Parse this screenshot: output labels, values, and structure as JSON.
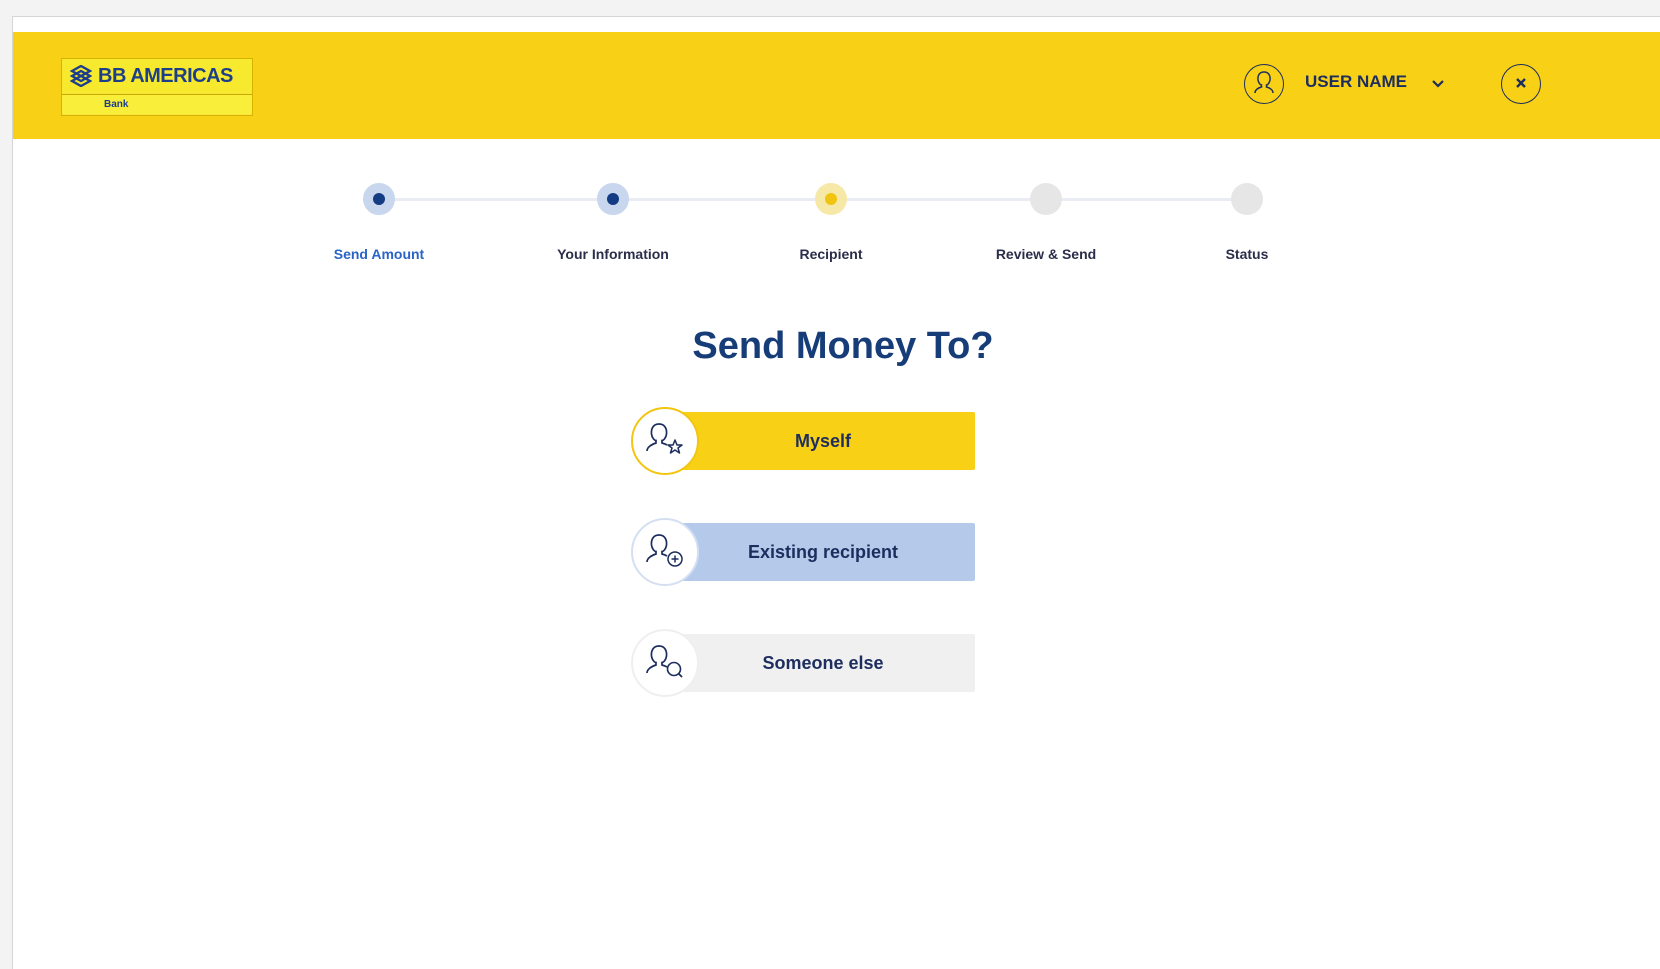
{
  "header": {
    "logo_text": "BB AMERICAS",
    "logo_subtext": "Bank",
    "user_name": "USER NAME"
  },
  "steps": [
    {
      "label": "Send Amount",
      "state": "done"
    },
    {
      "label": "Your Information",
      "state": "done"
    },
    {
      "label": "Recipient",
      "state": "current"
    },
    {
      "label": "Review & Send",
      "state": "todo"
    },
    {
      "label": "Status",
      "state": "todo"
    }
  ],
  "main": {
    "title": "Send Money To?",
    "options": [
      {
        "label": "Myself",
        "icon": "user-star-icon"
      },
      {
        "label": "Existing recipient",
        "icon": "user-add-icon"
      },
      {
        "label": "Someone else",
        "icon": "user-search-icon"
      }
    ]
  },
  "colors": {
    "brand_yellow": "#f8d117",
    "brand_blue": "#173d79",
    "existing_blue": "#b5c9ea",
    "neutral": "#f0f0f0"
  }
}
